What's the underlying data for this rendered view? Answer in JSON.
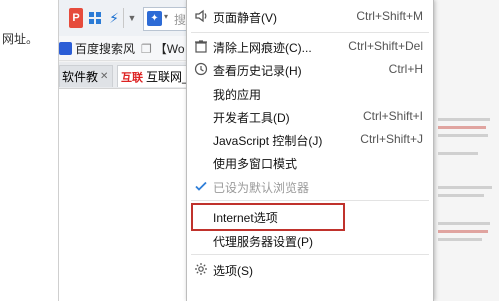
{
  "left_text": "网址。",
  "toolbar": {
    "p_icon_text": "P",
    "dropdown_icon": "chevron-down-icon",
    "search_placeholder": "搜"
  },
  "favorites": [
    {
      "label": "百度搜索风"
    },
    {
      "label": "【Wo"
    }
  ],
  "tabs": [
    {
      "label": "软件教",
      "close": "✕"
    },
    {
      "icon_text": "互联",
      "label": "互联网_"
    }
  ],
  "menu": {
    "items": [
      {
        "label": "页面静音(V)",
        "shortcut": "Ctrl+Shift+M",
        "icon": "speaker-icon"
      },
      {
        "label": "清除上网痕迹(C)...",
        "shortcut": "Ctrl+Shift+Del",
        "icon": "clear-icon"
      },
      {
        "label": "查看历史记录(H)",
        "shortcut": "Ctrl+H",
        "icon": "history-icon"
      },
      {
        "label": "我的应用",
        "shortcut": ""
      },
      {
        "label": "开发者工具(D)",
        "shortcut": "Ctrl+Shift+I"
      },
      {
        "label": "JavaScript 控制台(J)",
        "shortcut": "Ctrl+Shift+J"
      },
      {
        "label": "使用多窗口模式",
        "shortcut": ""
      },
      {
        "label": "已设为默认浏览器",
        "shortcut": "",
        "icon": "checkmark-icon",
        "disabled": true
      },
      {
        "label": "Internet选项",
        "shortcut": ""
      },
      {
        "label": "代理服务器设置(P)",
        "shortcut": ""
      },
      {
        "label": "选项(S)",
        "shortcut": "",
        "icon": "gear-icon"
      }
    ],
    "highlighted_item": "Internet选项"
  },
  "colors": {
    "highlight_border": "#c0322c",
    "check_blue": "#2f7fd8",
    "disabled_text": "#9a9a9a"
  }
}
